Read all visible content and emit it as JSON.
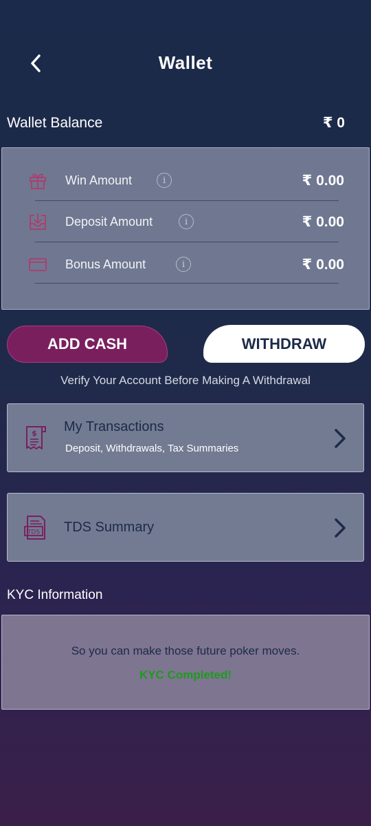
{
  "header": {
    "title": "Wallet",
    "back_icon": "chevron-left-icon"
  },
  "balance": {
    "label": "Wallet Balance",
    "amount": "₹ 0"
  },
  "amounts": [
    {
      "label": "Win Amount",
      "value": "₹ 0.00",
      "icon": "gift-icon"
    },
    {
      "label": "Deposit Amount",
      "value": "₹ 0.00",
      "icon": "deposit-tray-icon"
    },
    {
      "label": "Bonus Amount",
      "value": "₹ 0.00",
      "icon": "card-icon"
    }
  ],
  "info_glyph": "i",
  "actions": {
    "add_cash": "ADD CASH",
    "withdraw": "WITHDRAW",
    "verify_note": "Verify Your Account Before Making A Withdrawal"
  },
  "transactions": {
    "title": "My Transactions",
    "subtitle": "Deposit, Withdrawals, Tax Summaries",
    "icon": "receipt-icon"
  },
  "tds": {
    "title": "TDS Summary",
    "icon": "tds-document-icon",
    "icon_text": "TDS"
  },
  "kyc": {
    "heading": "KYC Information",
    "message": "So you can make those future poker moves.",
    "status": "KYC Completed!"
  },
  "colors": {
    "accent_pink": "#7a1f5e",
    "icon_pink": "#b03a6e",
    "success_green": "#1e9a1e",
    "navy": "#1c2a48"
  }
}
